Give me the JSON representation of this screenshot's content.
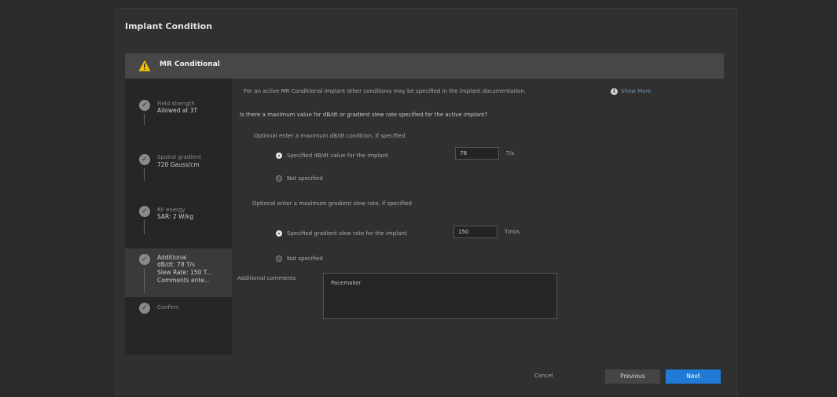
{
  "dialog": {
    "title": "Implant Condition",
    "banner": {
      "label": "MR Conditional",
      "icon": "warning-icon"
    }
  },
  "steps": [
    {
      "title": "Field strength",
      "value": "Allowed at 3T",
      "state": "done"
    },
    {
      "title": "Spatial gradient",
      "value": "720 Gauss/cm",
      "state": "done"
    },
    {
      "title": "RF energy",
      "value": "SAR: 2 W/kg",
      "state": "done"
    },
    {
      "title": "Additional",
      "lines": [
        "dB/dt: 78 T/s",
        "Slew Rate: 150 T...",
        "Comments ente..."
      ],
      "state": "active"
    },
    {
      "title": "Confirm",
      "state": "pending"
    }
  ],
  "main": {
    "intro": "For an active MR Conditional implant other conditions may be specified in the implant documentation.",
    "show_more": "Show More",
    "question": "Is there a maximum value for dB/dt or gradient slew rate specified for the active implant?",
    "dbdt": {
      "heading": "Optional enter a maximum dB/dt condition, if specified",
      "option_specified": "Specified dB/dt value for the implant",
      "value": "78",
      "unit": "T/s",
      "option_not": "Not specified"
    },
    "slew": {
      "heading": "Optional enter a maximum gradient slew rate, if specified",
      "option_specified": "Specified gradient slew rate for the implant",
      "value": "150",
      "unit": "T/m/s",
      "option_not": "Not specified"
    },
    "comments": {
      "label": "Additional comments",
      "value": "Pacemaker"
    }
  },
  "footer": {
    "cancel": "Cancel",
    "previous": "Previous",
    "next": "Next"
  },
  "colors": {
    "accent": "#1f7bd6",
    "warning": "#f2c200",
    "background": "#2b2b2b"
  }
}
